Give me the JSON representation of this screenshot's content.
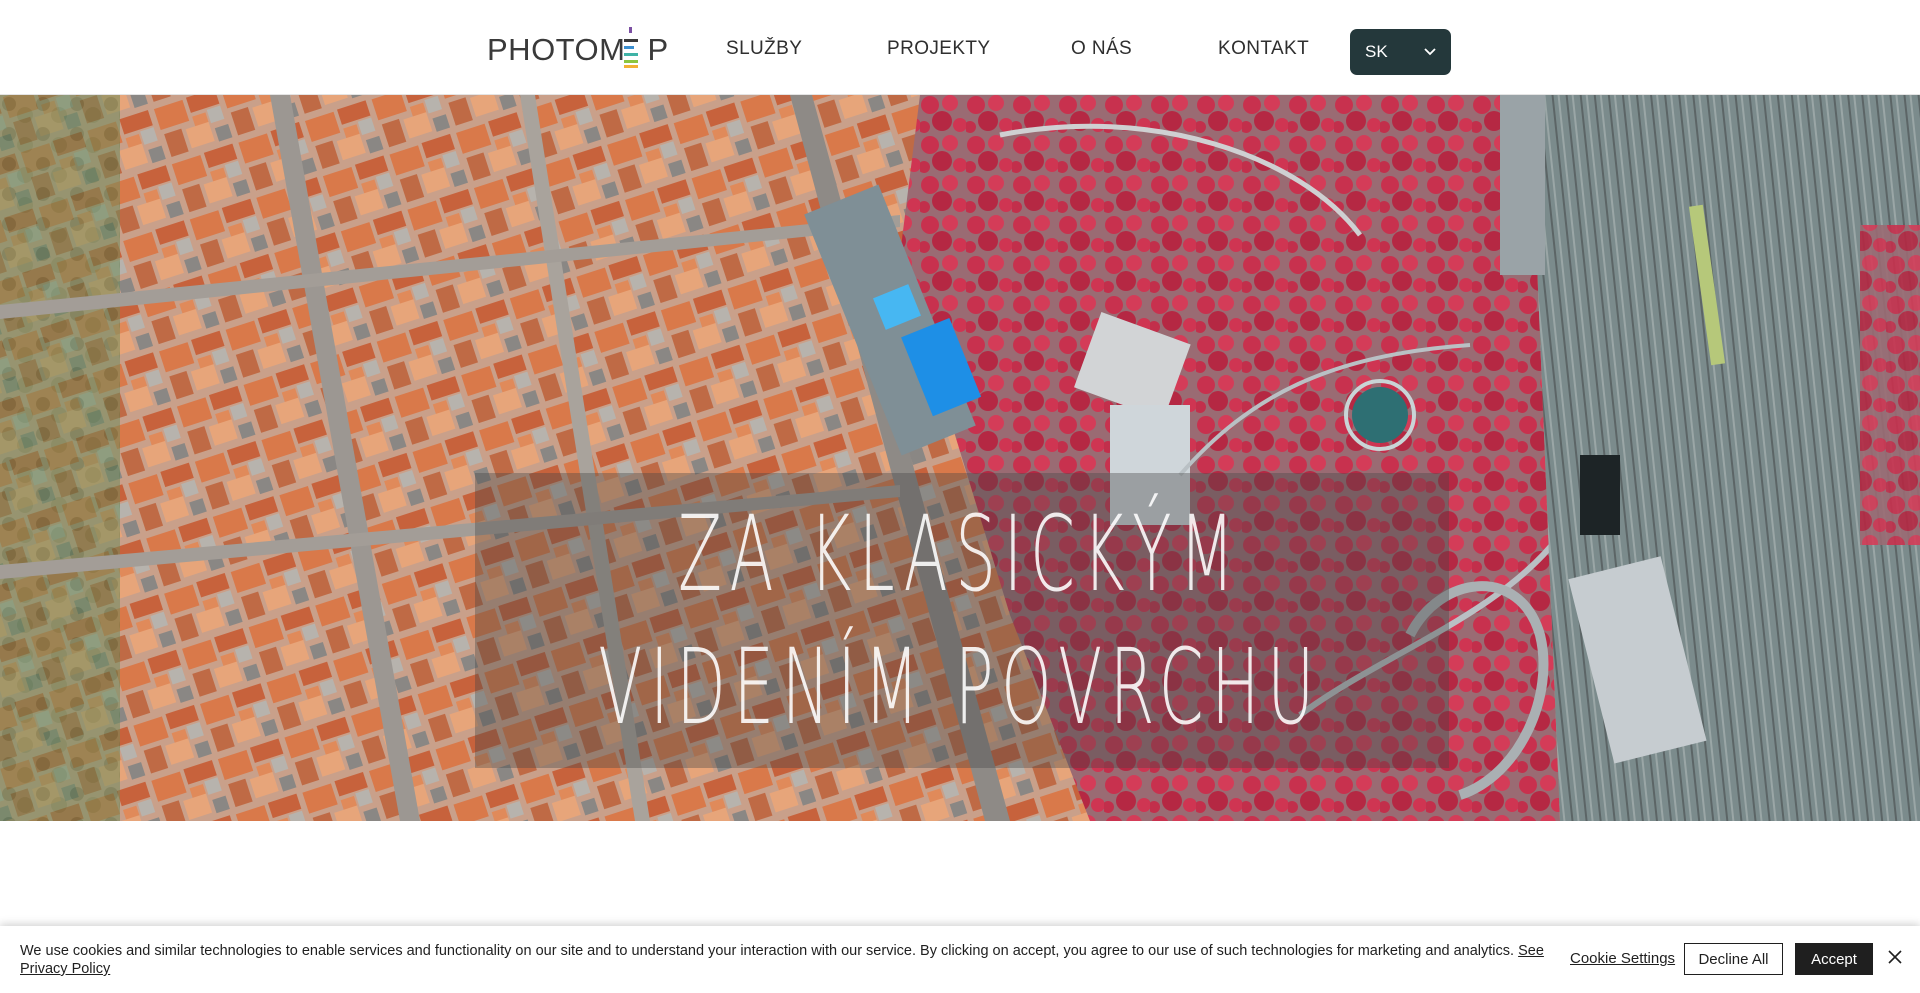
{
  "header": {
    "logo": {
      "text_left": "PHOTOM",
      "text_mid": "E",
      "text_right": "P",
      "bar_colors": [
        "#7b4fa2",
        "#3b8fd0",
        "#3fb3a6",
        "#8cc63f",
        "#f2b134"
      ]
    },
    "nav": [
      {
        "label": "SLUŽBY"
      },
      {
        "label": "PROJEKTY"
      },
      {
        "label": "O NÁS"
      },
      {
        "label": "KONTAKT"
      }
    ],
    "language": {
      "value": "SK",
      "icon": "chevron-down-icon"
    }
  },
  "hero": {
    "line1": "ZA KLASICKÝM",
    "line2": "VIDENÍM POVRCHU",
    "background": "aerial-infrared-city-photo"
  },
  "cookie_banner": {
    "text": "We use cookies and similar technologies to enable services and functionality on our site and to understand your interaction with our service. By clicking on accept, you agree to our use of such technologies for marketing and analytics.",
    "link_label": "See Privacy Policy",
    "settings_label": "Cookie Settings",
    "decline_label": "Decline All",
    "accept_label": "Accept",
    "close_icon": "close-icon"
  },
  "colors": {
    "lang_bg": "#24383b",
    "text_dark": "#2f2f2f",
    "vegetation_infrared": "#c8314e",
    "roofs": "#d9794a"
  }
}
